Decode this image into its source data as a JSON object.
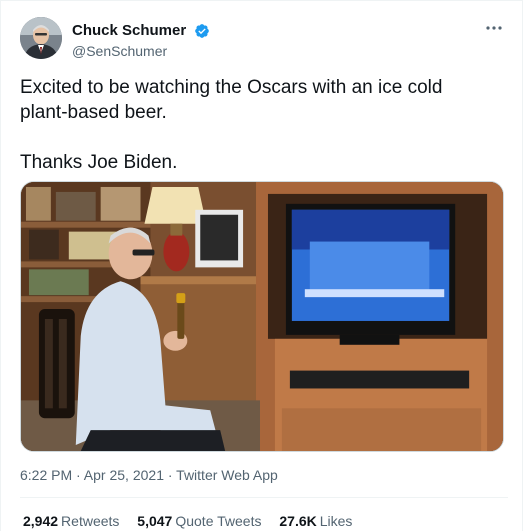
{
  "tweet": {
    "author": {
      "display_name": "Chuck Schumer",
      "handle": "@SenSchumer",
      "verified": true,
      "avatar_icon": "profile-photo"
    },
    "paragraphs": [
      "Excited to be watching the Oscars with an ice cold plant-based beer.",
      "Thanks Joe Biden."
    ],
    "timestamp": "6:22 PM · Apr 25, 2021 · Twitter Web App",
    "stats": {
      "retweets": {
        "count": "2,942",
        "label": "Retweets"
      },
      "quote_tweets": {
        "count": "5,047",
        "label": "Quote Tweets"
      },
      "likes": {
        "count": "27.6K",
        "label": "Likes"
      }
    },
    "more_icon": "more-icon"
  },
  "colors": {
    "text_primary": "#0f1419",
    "text_secondary": "#536471",
    "verified_blue": "#1d9bf0",
    "border": "#eff3f4"
  }
}
